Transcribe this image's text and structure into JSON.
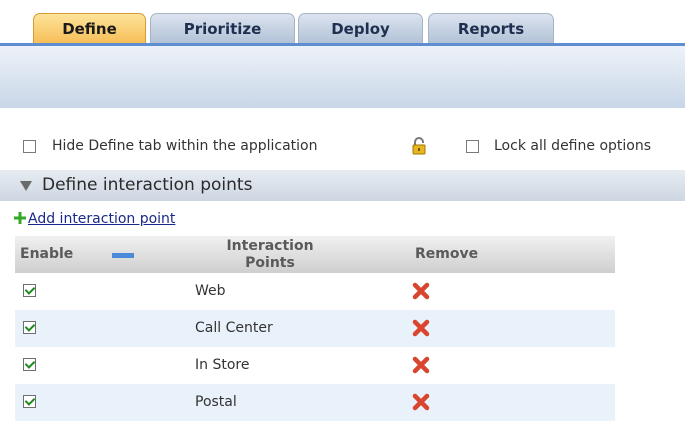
{
  "tabs": [
    {
      "label": "Define",
      "active": true
    },
    {
      "label": "Prioritize",
      "active": false
    },
    {
      "label": "Deploy",
      "active": false
    },
    {
      "label": "Reports",
      "active": false
    }
  ],
  "options": {
    "hide_define_label": "Hide Define tab within the application",
    "hide_define_checked": false,
    "lock_label": "Lock all define options",
    "lock_checked": false,
    "lock_icon": "unlocked-padlock-icon"
  },
  "section": {
    "title": "Define interaction points",
    "expanded": true
  },
  "add_link": {
    "label": "Add interaction point",
    "icon": "green-plus-icon"
  },
  "table": {
    "headers": {
      "enable": "Enable",
      "points": "Interaction Points",
      "remove": "Remove"
    },
    "rows": [
      {
        "enabled": true,
        "name": "Web"
      },
      {
        "enabled": true,
        "name": "Call Center"
      },
      {
        "enabled": true,
        "name": "In Store"
      },
      {
        "enabled": true,
        "name": "Postal"
      }
    ]
  },
  "colors": {
    "active_tab": "#f6be57",
    "inactive_tab": "#b2c2d7",
    "tab_underline": "#5e8ed0",
    "remove_icon": "#d9452f",
    "check_mark": "#1f8a20",
    "alt_row": "#e9f1fa"
  }
}
